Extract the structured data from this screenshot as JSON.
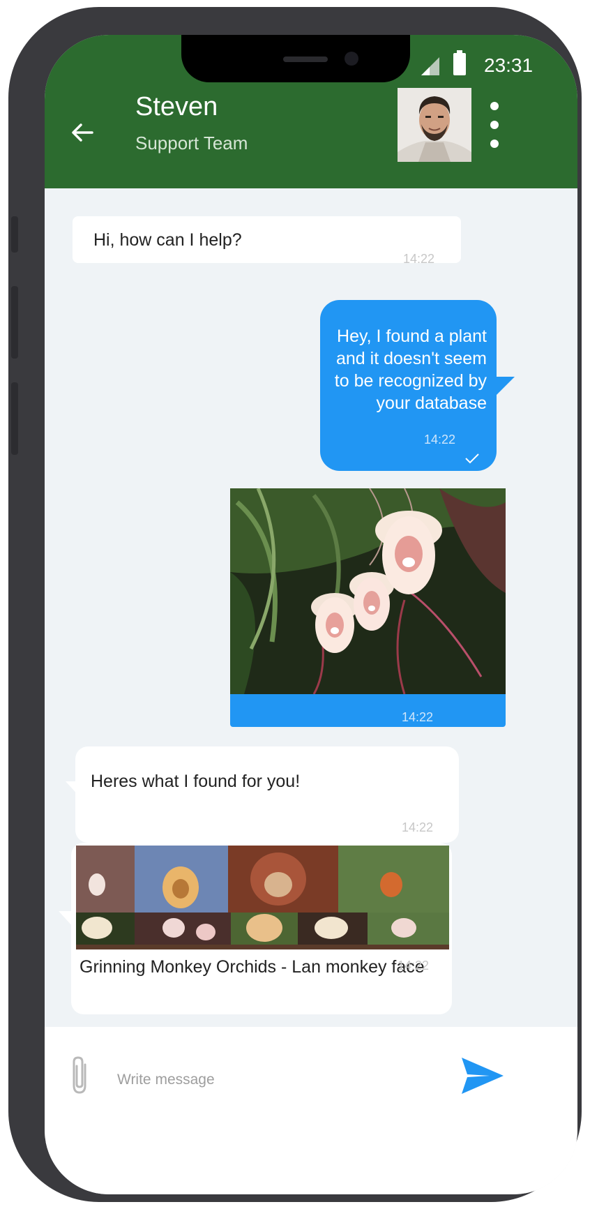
{
  "status_bar": {
    "time": "23:31"
  },
  "header": {
    "contact_name": "Steven",
    "contact_subtitle": "Support Team"
  },
  "messages": [
    {
      "direction": "incoming",
      "text": "Hi, how can I help?",
      "time": "14:22"
    },
    {
      "direction": "outgoing",
      "text_lines": [
        "Hey, I found a plant",
        "and it doesn't seem",
        "to be recognized by",
        "your database"
      ],
      "time": "14:22",
      "read_icon": "checkmark-icon"
    },
    {
      "direction": "outgoing",
      "type": "image",
      "image_subject": "monkey face orchid flowers",
      "time": "14:22"
    },
    {
      "direction": "incoming",
      "text": "Heres what I found for you!",
      "time": "14:22"
    },
    {
      "direction": "incoming",
      "type": "link-preview",
      "caption": "Grinning Monkey Orchids - Lan monkey face",
      "time": "14:22"
    }
  ],
  "composer": {
    "placeholder": "Write message"
  },
  "colors": {
    "header": "#2c6b2f",
    "outgoing_bubble": "#2196f3",
    "chat_background": "#eff3f6",
    "send_icon": "#2196f3"
  },
  "icons": {
    "back": "arrow-left-icon",
    "menu": "more-vertical-icon",
    "attach": "paperclip-icon",
    "send": "send-icon"
  }
}
